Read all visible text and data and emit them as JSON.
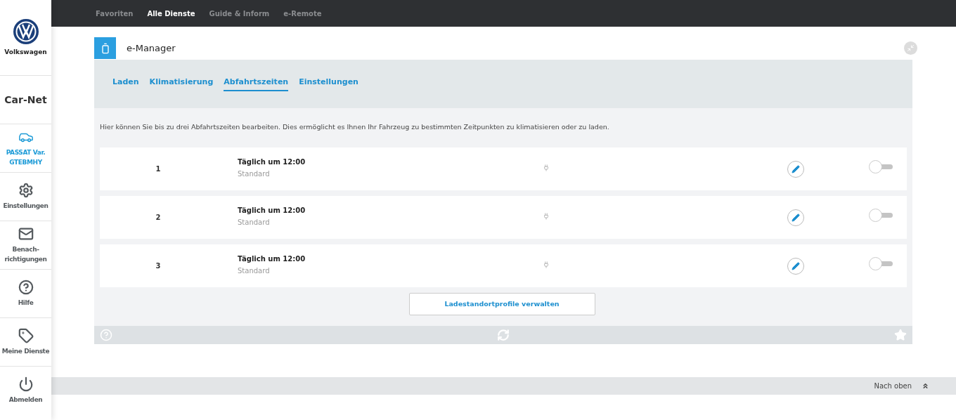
{
  "sidebar": {
    "brand": "Volkswagen",
    "title": "Car-Net",
    "items": [
      {
        "kind": "car",
        "label": "PASSAT Var. GTEBMHY",
        "selected": true
      },
      {
        "kind": "gear",
        "label": "Einstellungen",
        "selected": false
      },
      {
        "kind": "mail",
        "label": "Benach-richtigungen",
        "selected": false
      },
      {
        "kind": "help",
        "label": "Hilfe",
        "selected": false
      },
      {
        "kind": "tag",
        "label": "Meine Dienste",
        "selected": false
      },
      {
        "kind": "power",
        "label": "Abmelden",
        "selected": false
      }
    ]
  },
  "top_nav": [
    {
      "label": "Favoriten",
      "selected": false
    },
    {
      "label": "Alle Dienste",
      "selected": true
    },
    {
      "label": "Guide & Inform",
      "selected": false
    },
    {
      "label": "e-Remote",
      "selected": false
    }
  ],
  "panel": {
    "title": "e-Manager",
    "tabs": [
      {
        "label": "Laden",
        "selected": false
      },
      {
        "label": "Klimatisierung",
        "selected": false
      },
      {
        "label": "Abfahrtszeiten",
        "selected": true
      },
      {
        "label": "Einstellungen",
        "selected": false
      }
    ],
    "description": "Hier können Sie bis zu drei Abfahrtszeiten bearbeiten. Dies ermöglicht es Ihnen Ihr Fahrzeug zu bestimmten Zeitpunkten zu klimatisieren oder zu laden.",
    "rows": [
      {
        "number": "1",
        "title": "Täglich um 12:00",
        "subtitle": "Standard",
        "on": false
      },
      {
        "number": "2",
        "title": "Täglich um 12:00",
        "subtitle": "Standard",
        "on": false
      },
      {
        "number": "3",
        "title": "Täglich um 12:00",
        "subtitle": "Standard",
        "on": false
      }
    ],
    "button": "Ladestandortprofile verwalten"
  },
  "footer": {
    "back_to_top": "Nach oben"
  }
}
